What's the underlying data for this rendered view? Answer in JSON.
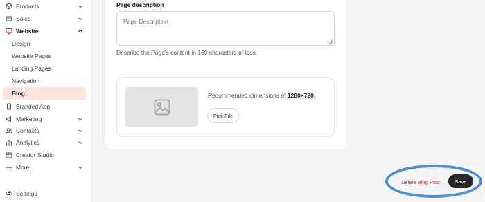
{
  "sidebar": {
    "items": [
      {
        "label": "Products",
        "icon": "box-icon",
        "chevron": "down"
      },
      {
        "label": "Sales",
        "icon": "credit-card-icon",
        "chevron": "down"
      },
      {
        "label": "Website",
        "icon": "monitor-icon",
        "chevron": "up"
      },
      {
        "label": "Design"
      },
      {
        "label": "Website Pages"
      },
      {
        "label": "Landing Pages"
      },
      {
        "label": "Navigation"
      },
      {
        "label": "Blog",
        "active": true
      },
      {
        "label": "Branded App",
        "icon": "phone-icon"
      },
      {
        "label": "Marketing",
        "icon": "megaphone-icon",
        "chevron": "down"
      },
      {
        "label": "Contacts",
        "icon": "users-icon",
        "chevron": "down"
      },
      {
        "label": "Analytics",
        "icon": "bar-chart-icon",
        "chevron": "down"
      },
      {
        "label": "Creator Studio",
        "icon": "calendar-icon"
      },
      {
        "label": "More",
        "icon": "dots-icon",
        "chevron": "down"
      },
      {
        "label": "Settings",
        "icon": "gear-icon"
      }
    ]
  },
  "main": {
    "page_description_label": "Page description",
    "page_description_placeholder": "Page Description",
    "page_description_help": "Describe the Page's content in 160 characters or less.",
    "image": {
      "recommended_prefix": "Recommended dimensions of ",
      "recommended_dims": "1280×720",
      "pick_file_label": "Pick File"
    }
  },
  "footer": {
    "delete_label": "Delete Blog Post",
    "save_label": "Save"
  },
  "colors": {
    "accent_active_bg": "#fde4de",
    "delete_text": "#dc2626",
    "save_bg": "#27272a",
    "highlight_ring": "#4a90d9",
    "website_icon": "#dc2626"
  }
}
